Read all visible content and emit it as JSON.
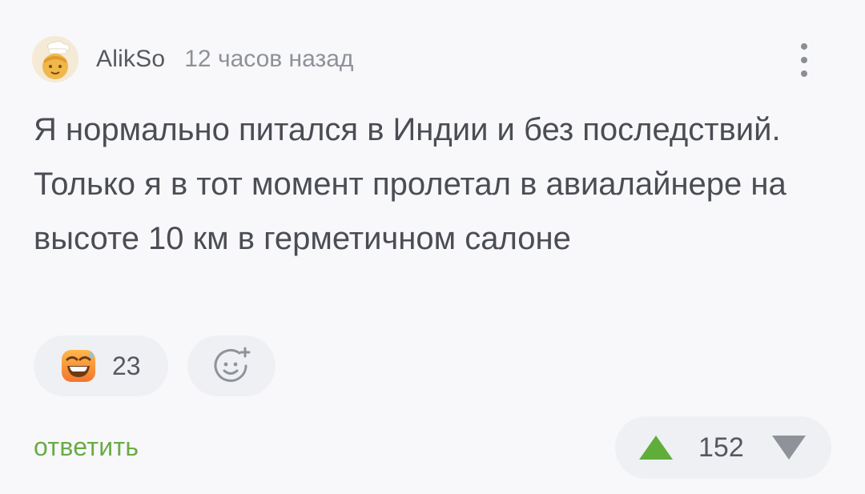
{
  "comment": {
    "author": "AlikSo",
    "timestamp": "12 часов назад",
    "text": "Я нормально питался в Индии и без последствий. Только я в тот момент пролетал в авиалайнере на высоте 10 км в герметичном салоне",
    "reactions": [
      {
        "icon": "grinning-sweat-emoji-icon",
        "count": "23"
      }
    ],
    "add_reaction_icon": "add-reaction-smiley-icon",
    "reply_label": "ответить",
    "rating": "152",
    "more_icon": "more-vertical-icon"
  },
  "colors": {
    "background": "#f8f8fa",
    "pill": "#eef0f3",
    "reply_green": "#6aab47",
    "upvote_green": "#5fae3a",
    "downvote_gray": "#8f9399",
    "text": "#4a4d54",
    "meta_text": "#8d9198"
  }
}
